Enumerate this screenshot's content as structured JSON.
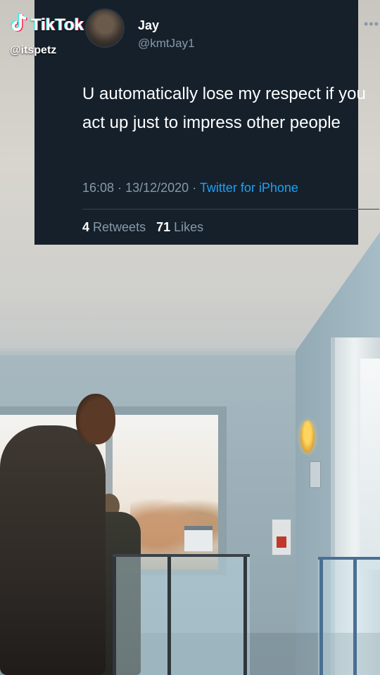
{
  "watermark": {
    "brand": "TikTok",
    "username": "@itspetz",
    "icon": "tiktok-note-icon"
  },
  "tweet": {
    "display_name": "Jay",
    "handle": "@kmtJay1",
    "more_icon": "more-horizontal-icon",
    "text": "U automatically lose my respect if you act up just to impress other people",
    "time": "16:08",
    "date": "13/12/2020",
    "separator": "·",
    "source": "Twitter for iPhone",
    "retweets_count": "4",
    "retweets_label": "Retweets",
    "likes_count": "71",
    "likes_label": "Likes",
    "colors": {
      "background": "#15202b",
      "text": "#ffffff",
      "muted": "#8899a6",
      "link": "#1da1f2"
    }
  }
}
